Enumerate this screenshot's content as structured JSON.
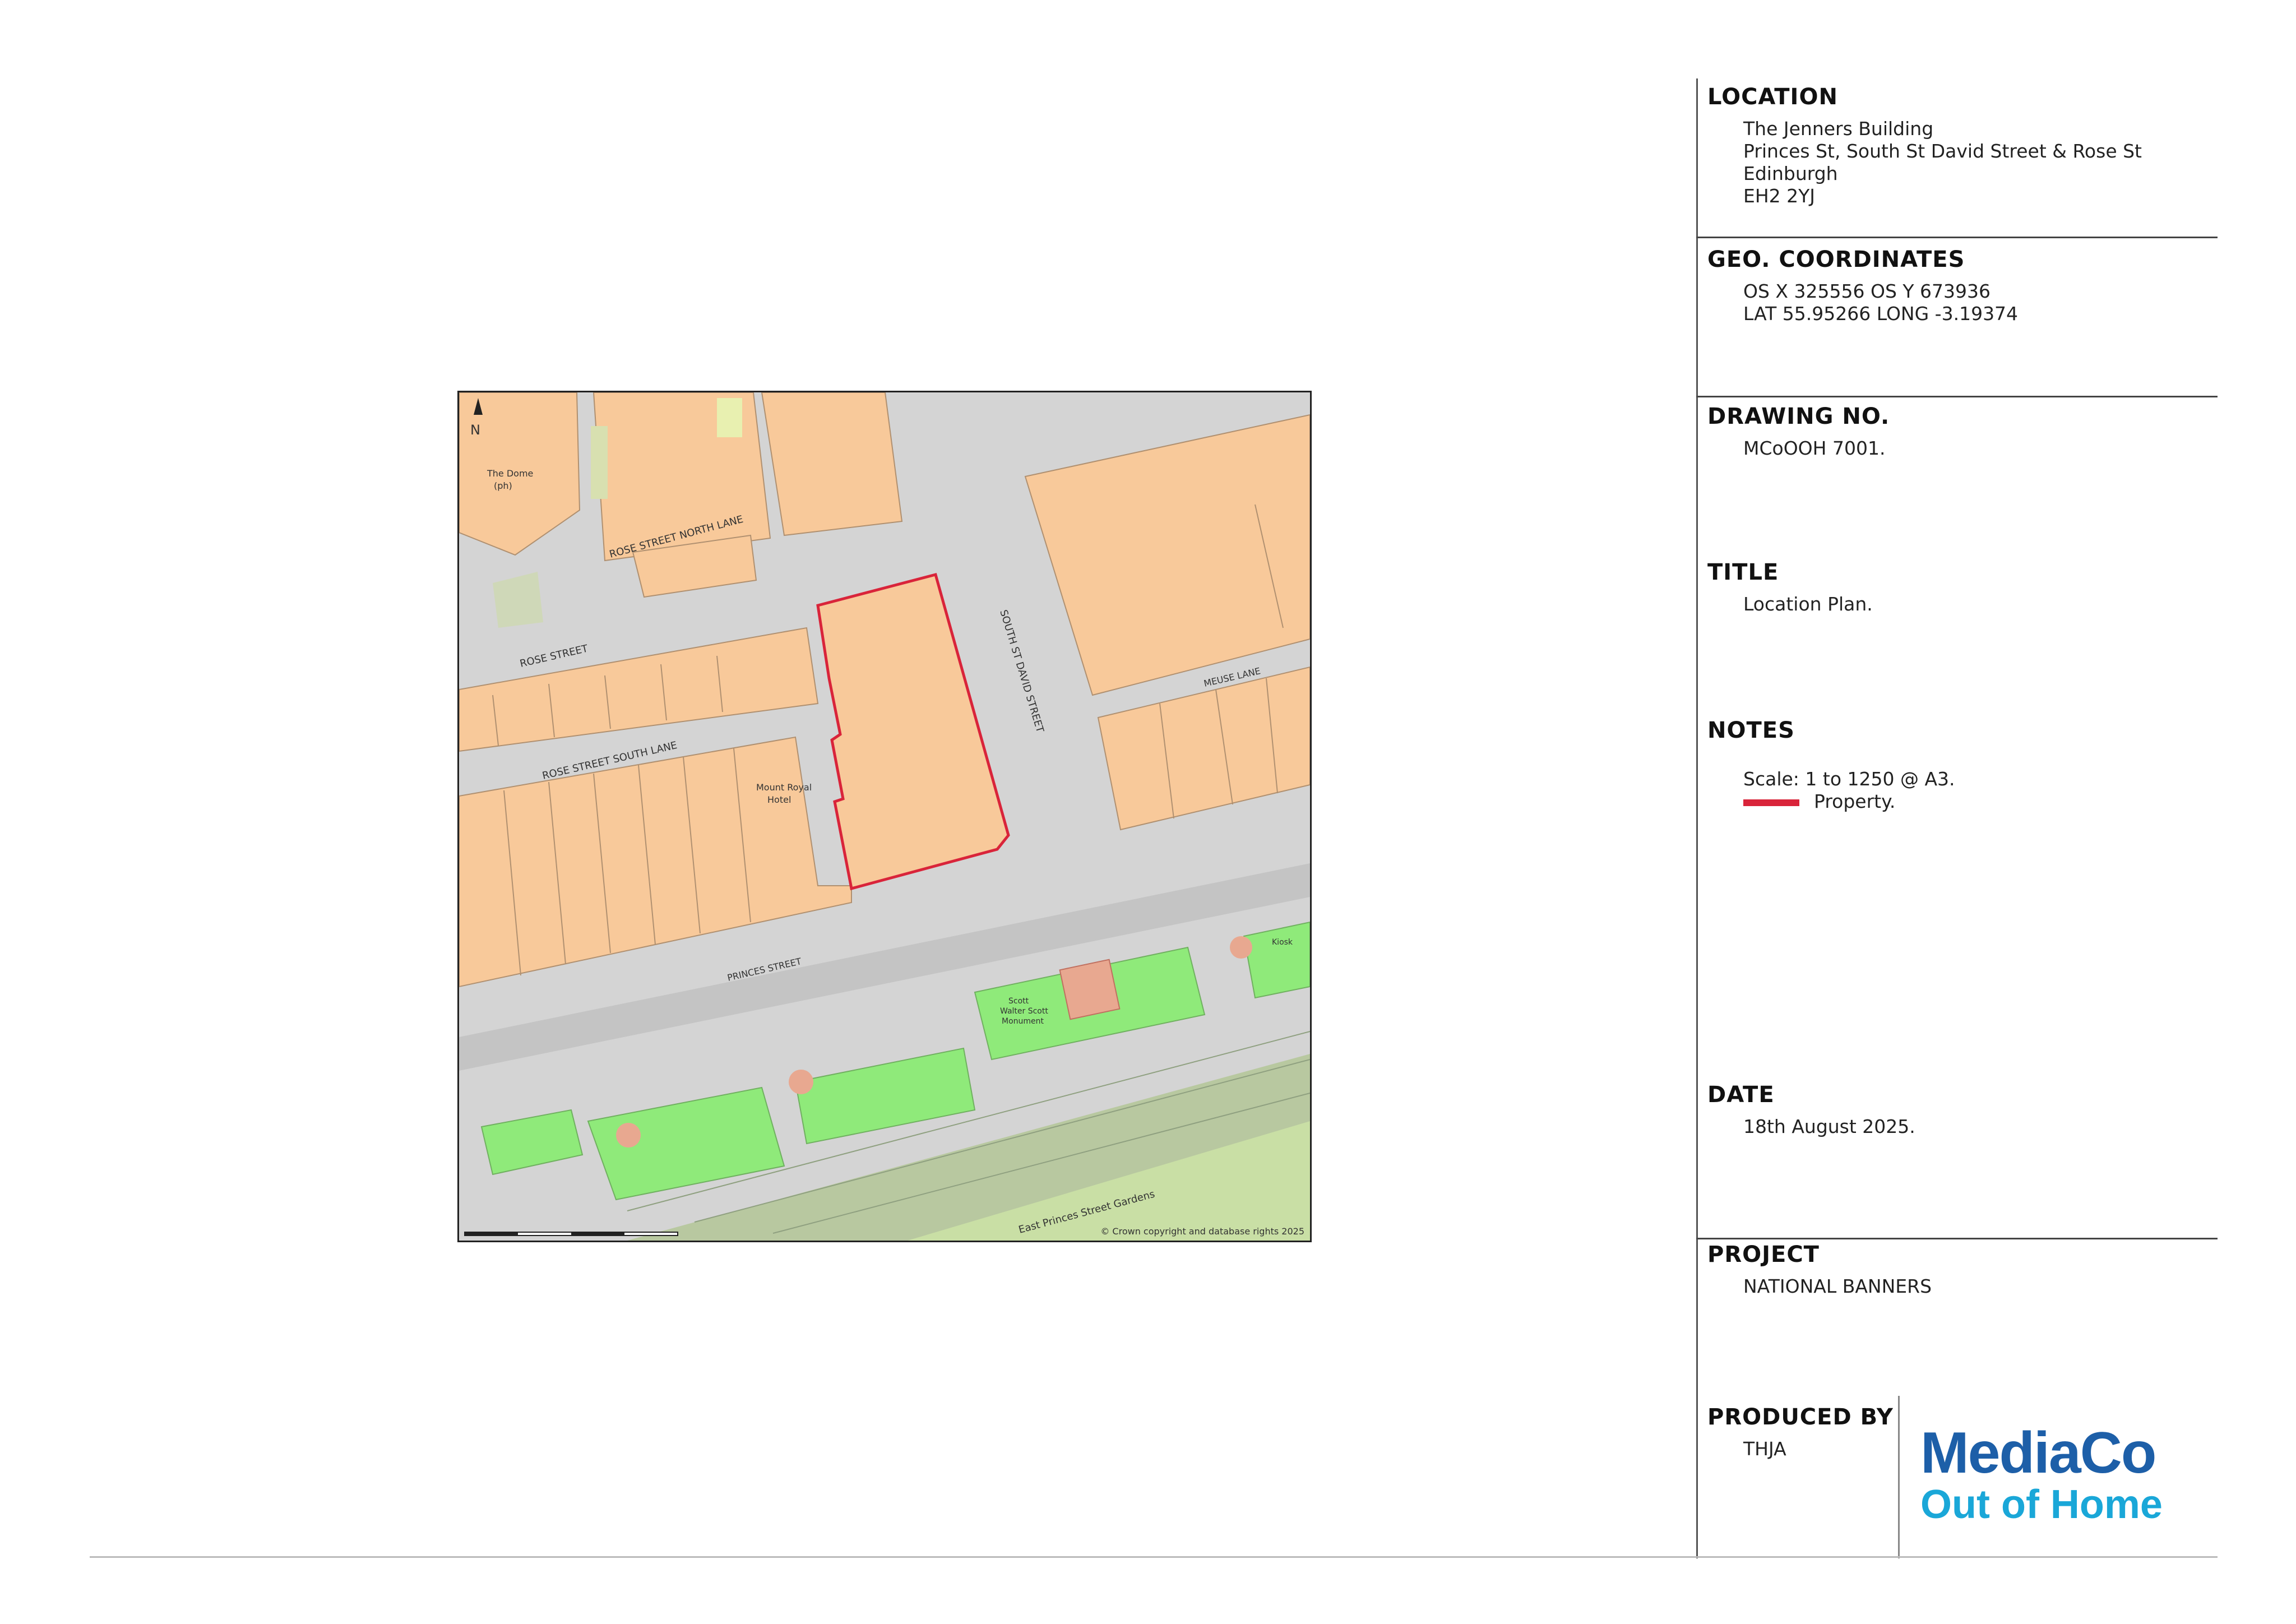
{
  "map": {
    "north_label": "N",
    "streets": {
      "rose_street_north_lane": "ROSE STREET NORTH LANE",
      "rose_street": "ROSE STREET",
      "rose_street_south_lane": "ROSE STREET SOUTH LANE",
      "south_st_david_street": "SOUTH ST DAVID STREET",
      "meuse_lane": "MEUSE LANE",
      "princes_street": "PRINCES STREET",
      "east_princes_street_gardens": "East Princes Street Gardens"
    },
    "places": {
      "the_dome": "The Dome",
      "the_dome_sub": "(ph)",
      "hotel": "Mount Royal",
      "hotel_sub": "Hotel",
      "monument": "Scott",
      "monument_line2": "Walter Scott",
      "monument_line3": "Monument",
      "kiosk": "Kiosk"
    },
    "copyright": "© Crown copyright and database rights 2025",
    "subject_property_color": "#d9243a"
  },
  "location": {
    "heading": "LOCATION",
    "lines": [
      "The Jenners Building",
      "Princes St, South St David Street & Rose St",
      "Edinburgh",
      "EH2 2YJ"
    ]
  },
  "geo": {
    "heading": "GEO. COORDINATES",
    "lines": [
      "OS X 325556 OS Y 673936",
      "LAT 55.95266 LONG -3.19374"
    ]
  },
  "drawing": {
    "heading": "DRAWING NO.",
    "value": "MCoOOH 7001."
  },
  "title": {
    "heading": "TITLE",
    "value": "Location Plan."
  },
  "notes": {
    "heading": "NOTES",
    "scale": "Scale: 1 to 1250 @ A3.",
    "legend_label": "Property.",
    "legend_color": "#d9243a"
  },
  "date": {
    "heading": "DATE",
    "value": "18th August 2025."
  },
  "project": {
    "heading": "PROJECT",
    "value": "NATIONAL BANNERS"
  },
  "produced_by": {
    "heading": "PRODUCED BY",
    "value": "THJA"
  },
  "logo": {
    "line1": "MediaCo",
    "line2": "Out of Home",
    "color_primary": "#1d5fa8",
    "color_secondary": "#1aa7d8"
  }
}
